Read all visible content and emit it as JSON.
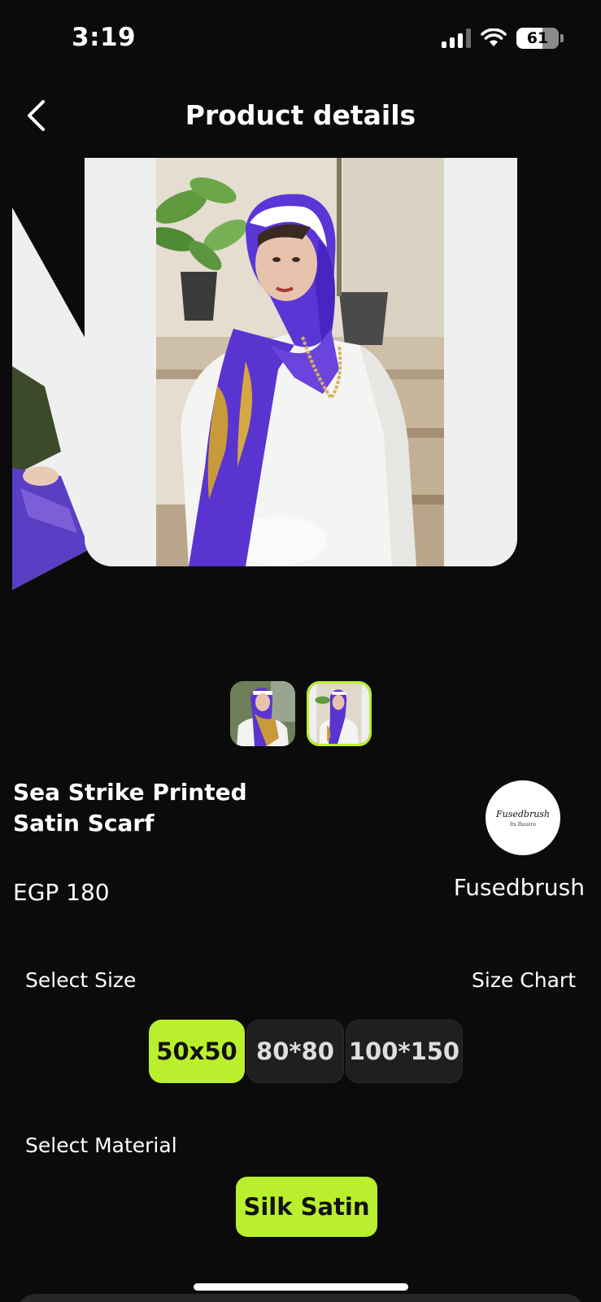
{
  "status_bar": {
    "time": "3:19",
    "battery": "61"
  },
  "header": {
    "title": "Product details"
  },
  "product": {
    "name": "Sea Strike  Printed Satin Scarf",
    "price": "EGP 180"
  },
  "brand": {
    "logo_text": "Fusedbrush",
    "logo_tagline": "Its Bizarre",
    "name": "Fusedbrush"
  },
  "size_section": {
    "label": "Select Size",
    "chart_link": "Size Chart",
    "options": [
      "50x50",
      "80*80",
      "100*150"
    ],
    "selected": "50x50"
  },
  "material_section": {
    "label": "Select Material",
    "options": [
      "Silk Satin"
    ],
    "selected": "Silk Satin"
  },
  "colors": {
    "accent": "#b9ef2f",
    "background": "#0b0b0b",
    "chip": "#1f1f1f"
  },
  "icons": {
    "back": "chevron-left-icon",
    "signal": "cellular-signal-icon",
    "wifi": "wifi-icon",
    "battery": "battery-icon"
  }
}
